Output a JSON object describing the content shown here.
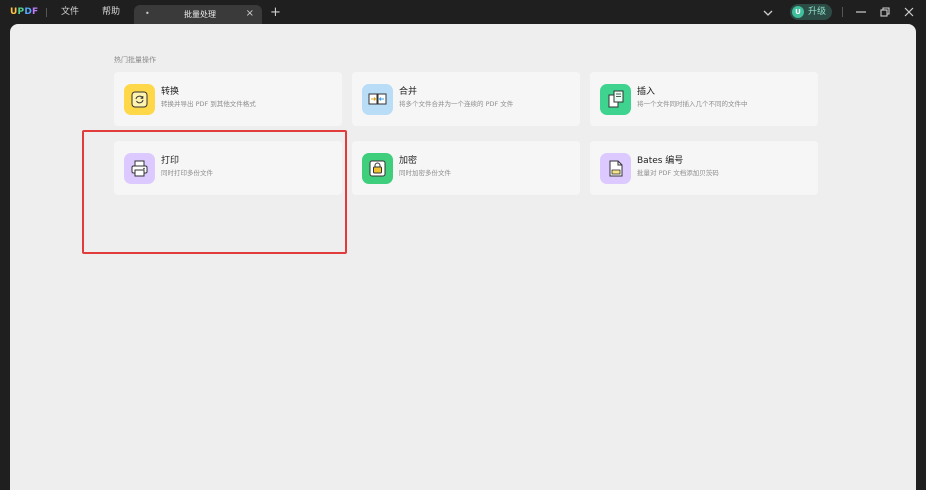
{
  "app": {
    "logo": [
      "U",
      "P",
      "D",
      "F"
    ]
  },
  "menu": {
    "file": "文件",
    "help": "帮助"
  },
  "tab": {
    "dot": "•",
    "title": "批量处理",
    "close": "×",
    "add": "+"
  },
  "account": {
    "avatar": "U",
    "upgrade": "升级"
  },
  "section": {
    "title": "热门批量操作"
  },
  "cards": [
    {
      "title": "转换",
      "desc": "转换并导出 PDF 到其他文件格式"
    },
    {
      "title": "合并",
      "desc": "将多个文件合并为一个连续的 PDF 文件"
    },
    {
      "title": "插入",
      "desc": "将一个文件同时插入几个不同的文件中"
    },
    {
      "title": "打印",
      "desc": "同时打印多份文件"
    },
    {
      "title": "加密",
      "desc": "同时加密多份文件"
    },
    {
      "title": "Bates 编号",
      "desc": "批量对 PDF 文档添加贝茨码"
    }
  ],
  "colors": {
    "convert": "#ffd84a",
    "merge": "#b9dcf7",
    "insert": "#3ed38e",
    "print": "#dcc9ff",
    "encrypt": "#3fce7c",
    "bates": "#dcc9ff",
    "highlight": "#e23b3b"
  }
}
